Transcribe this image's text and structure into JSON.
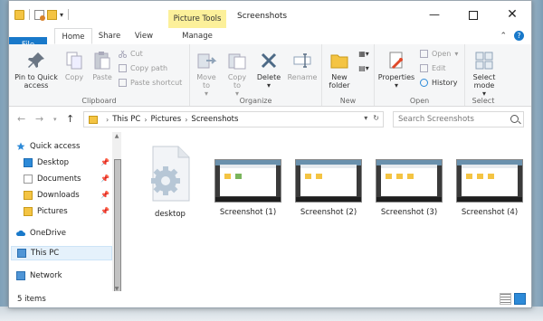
{
  "window": {
    "title": "Screenshots",
    "context_tab_header": "Picture Tools",
    "controls": {
      "minimize": "—",
      "close": "✕"
    }
  },
  "tabs": [
    "File",
    "Home",
    "Share",
    "View",
    "Manage"
  ],
  "ribbon": {
    "clipboard": {
      "label": "Clipboard",
      "pin": "Pin to Quick access",
      "copy": "Copy",
      "paste": "Paste",
      "cut": "Cut",
      "copy_path": "Copy path",
      "paste_shortcut": "Paste shortcut"
    },
    "organize": {
      "label": "Organize",
      "move_to": "Move to",
      "copy_to": "Copy to",
      "delete": "Delete",
      "rename": "Rename"
    },
    "new": {
      "label": "New",
      "new_folder": "New folder"
    },
    "open": {
      "label": "Open",
      "properties": "Properties",
      "open": "Open",
      "edit": "Edit",
      "history": "History"
    },
    "select": {
      "label": "Select",
      "select_mode": "Select mode"
    }
  },
  "address": {
    "crumbs": [
      "This PC",
      "Pictures",
      "Screenshots"
    ],
    "search_placeholder": "Search Screenshots"
  },
  "nav": {
    "quick_access": "Quick access",
    "pinned": [
      "Desktop",
      "Documents",
      "Downloads",
      "Pictures"
    ],
    "onedrive": "OneDrive",
    "this_pc": "This PC",
    "network": "Network"
  },
  "files": [
    {
      "name": "desktop",
      "kind": "settings-file"
    },
    {
      "name": "Screenshot (1)",
      "kind": "image"
    },
    {
      "name": "Screenshot (2)",
      "kind": "image"
    },
    {
      "name": "Screenshot (3)",
      "kind": "image"
    },
    {
      "name": "Screenshot (4)",
      "kind": "image"
    }
  ],
  "status": {
    "item_count": "5 items"
  },
  "colors": {
    "accent": "#1979ca",
    "picture_tools": "#fcf09a",
    "folder": "#f4c443"
  }
}
